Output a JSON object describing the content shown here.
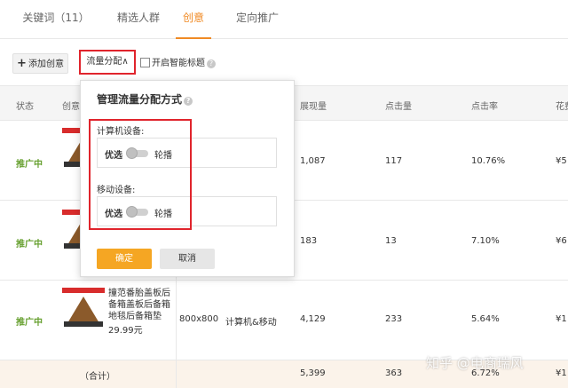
{
  "tabs": [
    {
      "label": "关键词（11）"
    },
    {
      "label": "精选人群"
    },
    {
      "label": "创意"
    },
    {
      "label": "定向推广"
    }
  ],
  "toolbar": {
    "add_label": "添加创意",
    "flow_label": "流量分配∧",
    "smart_label": "开启智能标题"
  },
  "table": {
    "headers": {
      "status": "状态",
      "creative": "创意",
      "impressions": "展现量",
      "clicks": "点击量",
      "ctr": "点击率",
      "cost": "花费"
    },
    "rows": [
      {
        "status": "推广中",
        "impressions": "1,087",
        "clicks": "117",
        "ctr": "10.76%",
        "cost": "¥5"
      },
      {
        "status": "推广中",
        "impressions": "183",
        "clicks": "13",
        "ctr": "7.10%",
        "cost": "¥6"
      },
      {
        "status": "推广中",
        "title": "撞范番胎盖板后备箱盖板后备箱地毯后备箱垫",
        "price": "29.99元",
        "size": "800x800",
        "device": "计算机&移动",
        "impressions": "4,129",
        "clicks": "233",
        "ctr": "5.64%",
        "cost": "¥1"
      }
    ],
    "sum": {
      "label": "（合计）",
      "impressions": "5,399",
      "clicks": "363",
      "ctr": "6.72%",
      "cost": "¥1"
    }
  },
  "popup": {
    "title": "管理流量分配方式",
    "pc_label": "计算机设备:",
    "mobile_label": "移动设备:",
    "opt_left": "优选",
    "opt_right": "轮播",
    "ok_label": "确定",
    "cancel_label": "取消"
  },
  "watermark": "知乎 @电商瑞风",
  "colors": {
    "accent": "#f08a24",
    "highlight_red": "#e0242c",
    "status_green": "#67a030",
    "ok_button": "#f5a623"
  }
}
